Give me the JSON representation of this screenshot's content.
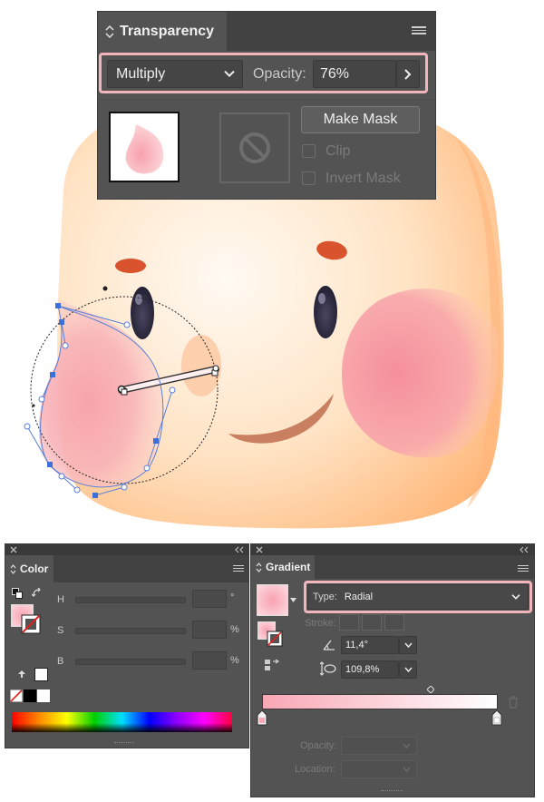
{
  "transparency": {
    "title": "Transparency",
    "blend_mode": "Multiply",
    "opacity_label": "Opacity:",
    "opacity_value": "76%",
    "make_mask_label": "Make Mask",
    "clip_label": "Clip",
    "invert_mask_label": "Invert Mask",
    "clip_checked": false,
    "invert_mask_checked": false
  },
  "color": {
    "title": "Color",
    "h_label": "H",
    "h_unit": "°",
    "s_label": "S",
    "s_unit": "%",
    "b_label": "B",
    "b_unit": "%"
  },
  "gradient": {
    "title": "Gradient",
    "type_label": "Type:",
    "type_value": "Radial",
    "stroke_label": "Stroke:",
    "angle_value": "11,4°",
    "aspect_value": "109,8%",
    "opacity_label": "Opacity:",
    "location_label": "Location:",
    "start_color": "#f8a7b4",
    "end_color": "#ffffff"
  },
  "colors": {
    "accent_highlight": "#f3b5bc",
    "panel_bg": "#535353",
    "tab_bar": "#424242",
    "blush": "#f79aa4",
    "face": "#ffd4aa"
  }
}
